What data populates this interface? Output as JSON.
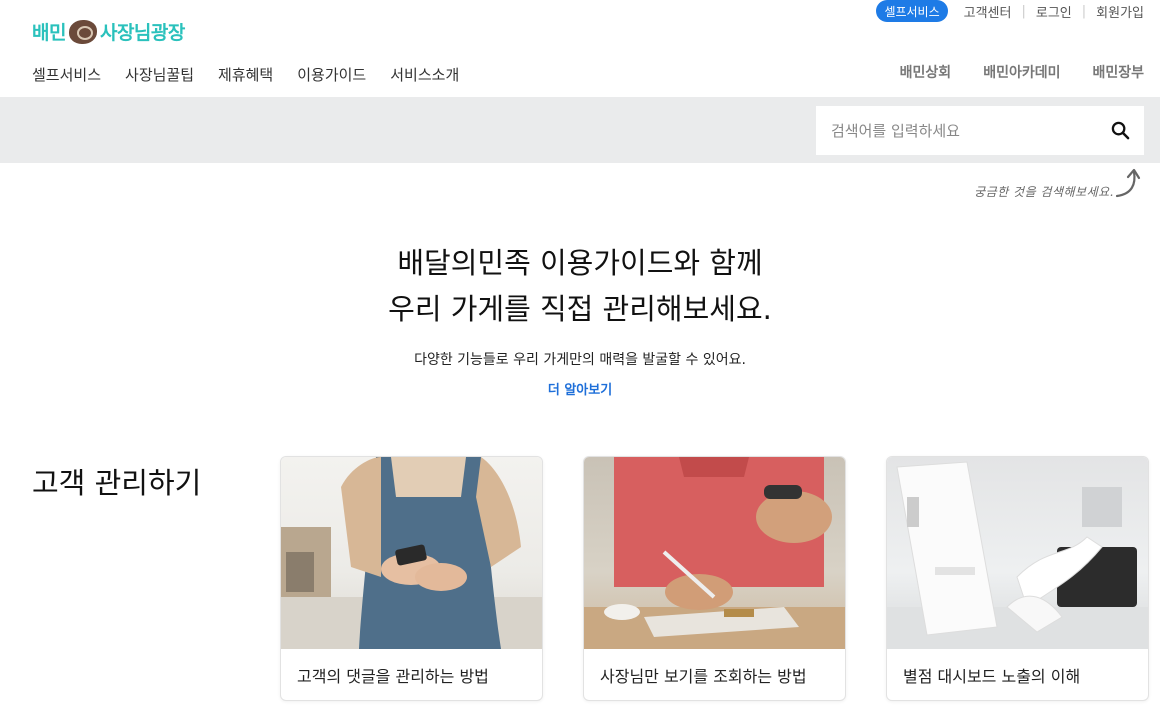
{
  "brand": {
    "logo_left": "배민",
    "logo_right": "사장님광장"
  },
  "util": {
    "selfservice_pill": "셀프서비스",
    "links": [
      "고객센터",
      "로그인",
      "회원가입"
    ]
  },
  "gnb": [
    "셀프서비스",
    "사장님꿀팁",
    "제휴혜택",
    "이용가이드",
    "서비스소개"
  ],
  "brands": [
    "배민상회",
    "배민아카데미",
    "배민장부"
  ],
  "search": {
    "placeholder": "검색어를 입력하세요",
    "hand_note": "궁금한 것을 검색해보세요."
  },
  "hero": {
    "title_line1": "배달의민족 이용가이드와 함께",
    "title_line2": "우리 가게를 직접 관리해보세요.",
    "desc": "다양한 기능들로 우리 가게만의 매력을 발굴할 수 있어요.",
    "more": "더 알아보기"
  },
  "section": {
    "title": "고객 관리하기",
    "cards": [
      {
        "caption": "고객의 댓글을 관리하는 방법",
        "image": "woman-with-phone"
      },
      {
        "caption": "사장님만 보기를 조회하는 방법",
        "image": "man-writing-notes"
      },
      {
        "caption": "별점 대시보드 노출의 이해",
        "image": "receipt-printer"
      }
    ]
  },
  "colors": {
    "accent": "#2ac1bc",
    "pill": "#1e7be6",
    "link": "#1e6fd9",
    "band": "#eaebec"
  }
}
